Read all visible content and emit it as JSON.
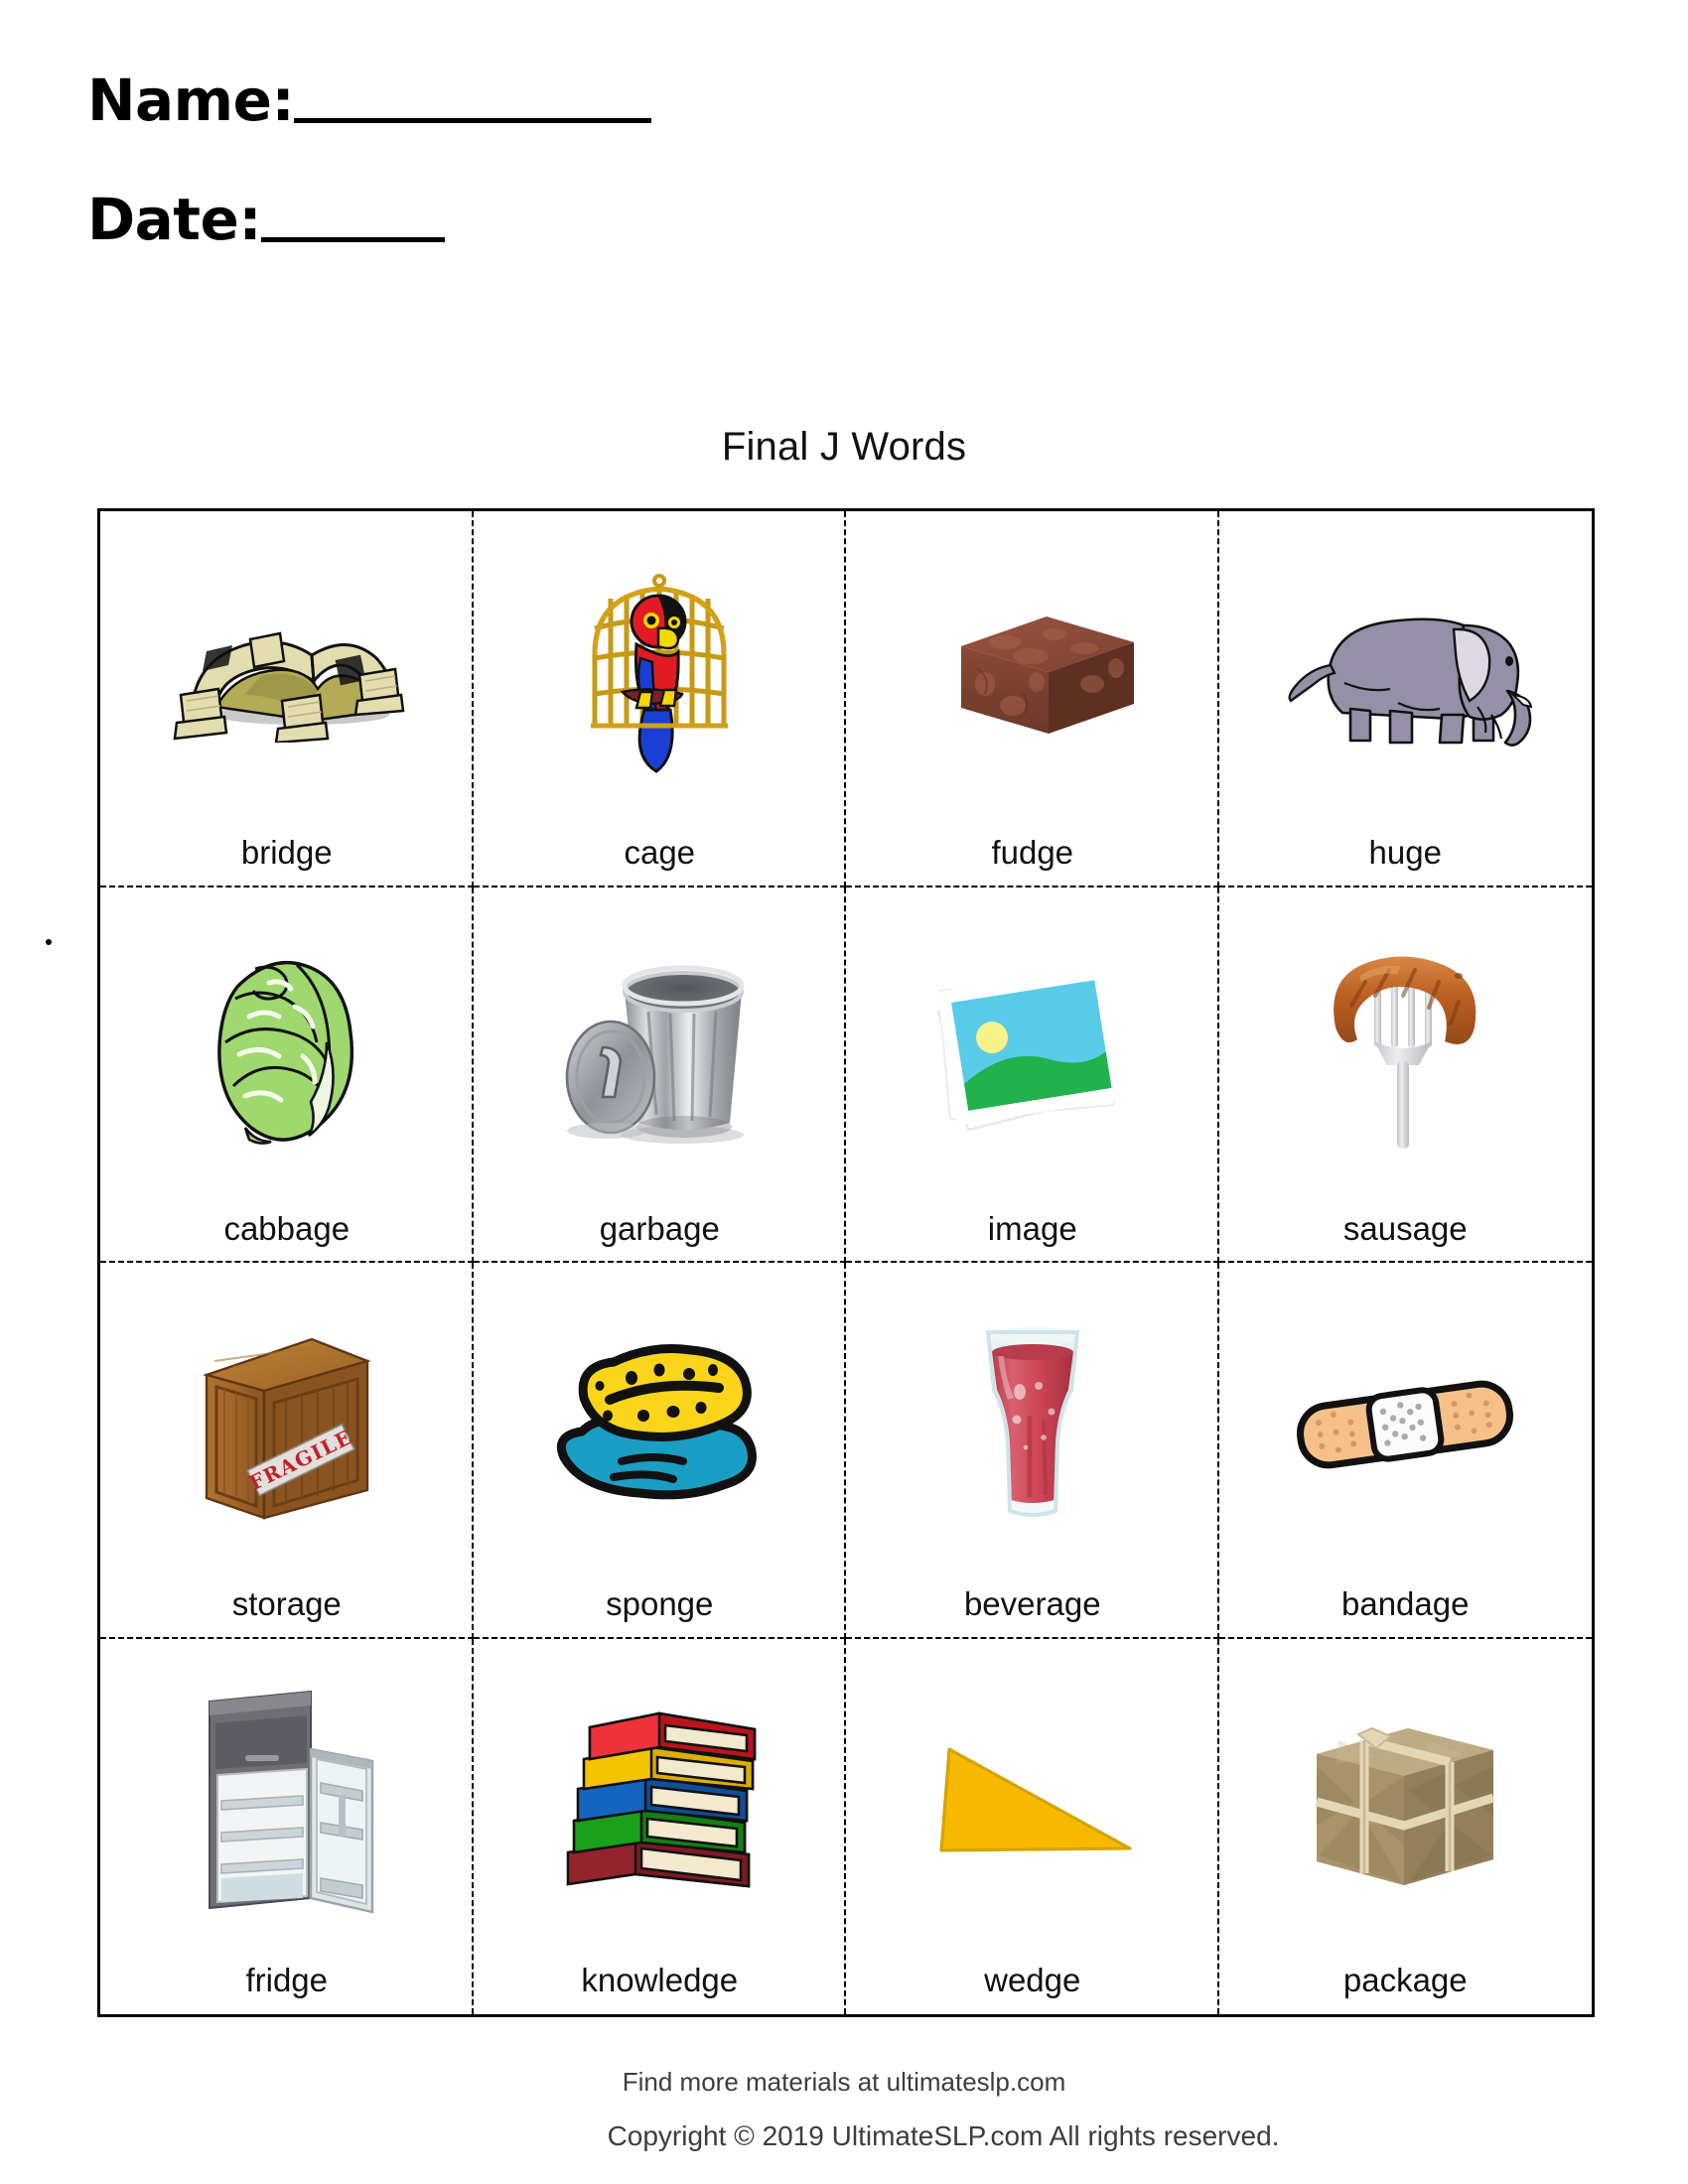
{
  "header": {
    "name_label": "Name:",
    "date_label": "Date:"
  },
  "title": "Final J Words",
  "grid": {
    "rows": 4,
    "cols": 4,
    "cells": [
      {
        "word": "bridge",
        "icon": "stone-arch-bridge-icon"
      },
      {
        "word": "cage",
        "icon": "birdcage-with-parrot-icon"
      },
      {
        "word": "fudge",
        "icon": "fudge-block-icon"
      },
      {
        "word": "huge",
        "icon": "elephant-icon"
      },
      {
        "word": "cabbage",
        "icon": "cabbage-icon"
      },
      {
        "word": "garbage",
        "icon": "trash-can-icon"
      },
      {
        "word": "image",
        "icon": "photo-stack-icon"
      },
      {
        "word": "sausage",
        "icon": "sausage-on-fork-icon"
      },
      {
        "word": "storage",
        "icon": "fragile-wooden-crate-icon"
      },
      {
        "word": "sponge",
        "icon": "sponge-with-water-icon"
      },
      {
        "word": "beverage",
        "icon": "glass-of-juice-icon"
      },
      {
        "word": "bandage",
        "icon": "adhesive-bandage-icon"
      },
      {
        "word": "fridge",
        "icon": "open-refrigerator-icon"
      },
      {
        "word": "knowledge",
        "icon": "stack-of-books-icon"
      },
      {
        "word": "wedge",
        "icon": "yellow-wedge-triangle-icon"
      },
      {
        "word": "package",
        "icon": "wrapped-parcel-icon"
      }
    ]
  },
  "footer": {
    "promo": "Find more materials at ultimateslp.com",
    "copyright": "Copyright © 2019 UltimateSLP.com All rights reserved."
  },
  "colors": {
    "bridge_stone": "#cfc98a",
    "bridge_deck": "#b3ab55",
    "cage_gold": "#d4a017",
    "parrot_red": "#e01b24",
    "parrot_blue": "#1a3fd4",
    "parrot_yellow": "#f5d800",
    "fudge_brown": "#8a4a36",
    "elephant_gray": "#9590a8",
    "cabbage_green": "#9fd86f",
    "trash_silver": "#b9bcc0",
    "photo_sky": "#59cbe8",
    "photo_green": "#22b14c",
    "photo_sun": "#f7f18a",
    "sausage_brown": "#c06528",
    "fork_gray": "#c9ccd0",
    "crate_wood": "#a36a2b",
    "fragile_red": "#c0202a",
    "sponge_yellow": "#fbd51c",
    "water_blue": "#1b9ec4",
    "beverage_red": "#cf4758",
    "bandage_peach": "#f6c08b",
    "fridge_gray": "#6e6e74",
    "book_red": "#e01b24",
    "book_yellow": "#f5c400",
    "book_blue": "#1565c0",
    "book_green": "#1aa01a",
    "book_darkred": "#93232c",
    "wedge_gold": "#f9b900",
    "package_tan": "#a8936b"
  }
}
